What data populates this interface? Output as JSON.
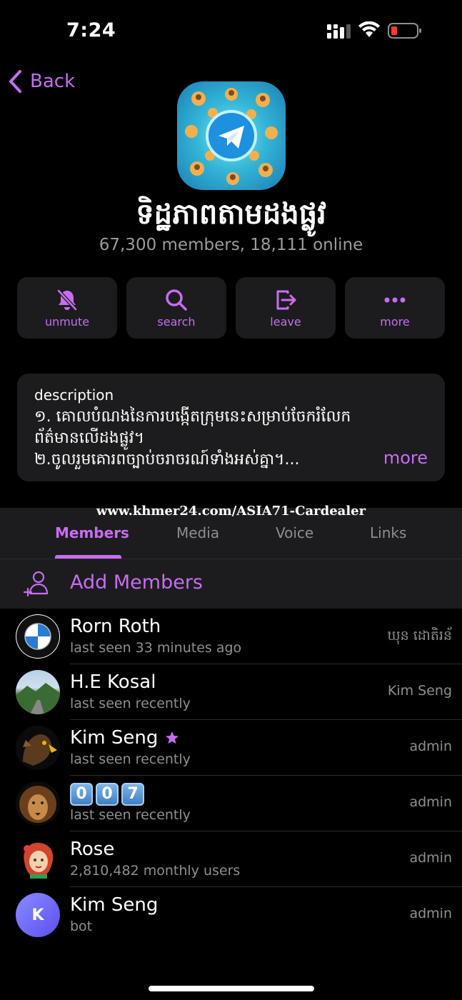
{
  "status_bar": {
    "time": "7:24",
    "battery_color": "#ff3b30"
  },
  "nav": {
    "back_label": "Back"
  },
  "group": {
    "title": "ទិដ្ឋភាពតាមដងផ្លូវ",
    "subtitle": "67,300 members, 18,111 online",
    "avatar_icon": "telegram-logo-icon"
  },
  "actions": [
    {
      "label": "unmute",
      "icon": "bell-slash-icon"
    },
    {
      "label": "search",
      "icon": "search-icon"
    },
    {
      "label": "leave",
      "icon": "leave-icon"
    },
    {
      "label": "more",
      "icon": "more-dots-icon"
    }
  ],
  "description": {
    "label": "description",
    "text": "១. គោលបំណងនៃការបង្កើតក្រុមនេះសម្រាប់ចែករំលែកព័ត៌មានលើដងផ្លូវ។\n២.ចូលរួមគោរពច្បាប់ចរាចរណ៍ទាំងអស់គ្នា។...",
    "more_label": "more"
  },
  "watermark": "www.khmer24.com/ASIA71-Cardealer",
  "tabs": [
    {
      "label": "Members",
      "active": true
    },
    {
      "label": "Media",
      "active": false
    },
    {
      "label": "Voice",
      "active": false
    },
    {
      "label": "Links",
      "active": false
    }
  ],
  "add_members_label": "Add Members",
  "members": [
    {
      "name": "Rorn Roth",
      "status": "last seen 33 minutes ago",
      "role": "ឃុន ដោតិរន័",
      "avatar": "bmw-logo"
    },
    {
      "name": "H.E Kosal",
      "status": "last seen recently",
      "role": "Kim Seng",
      "avatar": "landscape-photo"
    },
    {
      "name": "Kim Seng",
      "status": "last seen recently",
      "role": "admin",
      "avatar": "eagle-photo",
      "premium": true
    },
    {
      "name": "",
      "keycaps": [
        "0",
        "0",
        "7"
      ],
      "status": "last seen recently",
      "role": "admin",
      "avatar": "lion-photo"
    },
    {
      "name": "Rose",
      "status": "2,810,482 monthly users",
      "role": "admin",
      "avatar": "rose-cartoon"
    },
    {
      "name": "Kim Seng",
      "status": "bot",
      "role": "admin",
      "avatar": "initial-avatar",
      "initial": "K"
    }
  ],
  "colors": {
    "accent": "#c86df2",
    "background": "#000000",
    "card": "#1c1c1e",
    "muted": "#8e8e93"
  }
}
